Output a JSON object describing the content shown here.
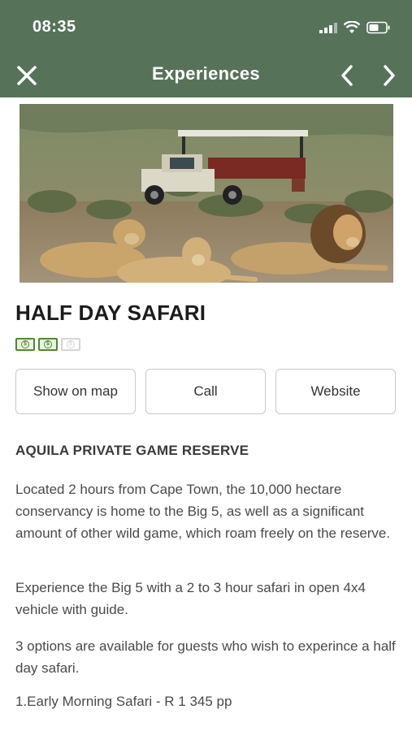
{
  "status_bar": {
    "time": "08:35"
  },
  "nav": {
    "title": "Experiences"
  },
  "listing": {
    "title": "HALF DAY SAFARI",
    "price_level": 2,
    "price_max": 3
  },
  "actions": {
    "map_label": "Show on map",
    "call_label": "Call",
    "website_label": "Website"
  },
  "details": {
    "heading": "AQUILA PRIVATE GAME RESERVE",
    "paragraphs": [
      "Located 2 hours from Cape Town, the 10,000 hectare conservancy is home to the Big 5, as well as a significant amount of other wild game, which roam freely on the reserve.",
      "Experience the Big 5 with a 2 to 3 hour safari in open 4x4 vehicle with guide.",
      "3 options are available for guests who wish to experince a half day safari.",
      "1.Early Morning Safari -  R 1 345 pp"
    ]
  },
  "colors": {
    "header_bg": "#56735a",
    "price_icon": "#4f8a2f"
  }
}
